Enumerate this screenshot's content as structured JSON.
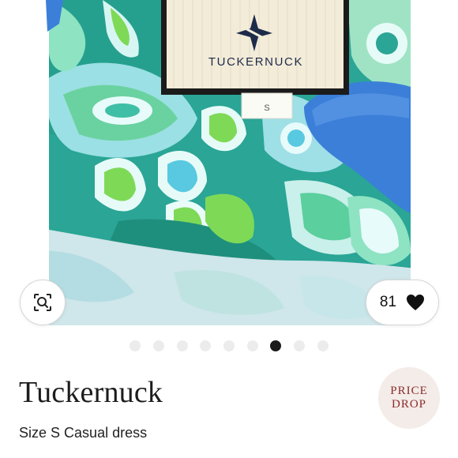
{
  "colors": {
    "teal": "#1f9a8a",
    "aqua": "#6fd4d6",
    "lime": "#7ed957",
    "blue_glove": "#3b7fd9",
    "label_cream": "#f3ecd9",
    "price_drop_bg": "#f3ece8",
    "price_drop_text": "#8c2b2b",
    "active_dot": "#1a1a1a",
    "inactive_dot": "#ececec"
  },
  "photo": {
    "label_brand": "TUCKERNUCK",
    "size_tag": "S"
  },
  "icons": {
    "search": "image-search-icon",
    "like": "heart-icon",
    "logo": "star-logo-icon"
  },
  "actions": {
    "like_count": "81"
  },
  "carousel": {
    "total": 9,
    "active_index": 6
  },
  "listing": {
    "brand": "Tuckernuck",
    "size_label": "Size S",
    "category": "Casual dress",
    "badge_line1": "PRICE",
    "badge_line2": "DROP"
  }
}
